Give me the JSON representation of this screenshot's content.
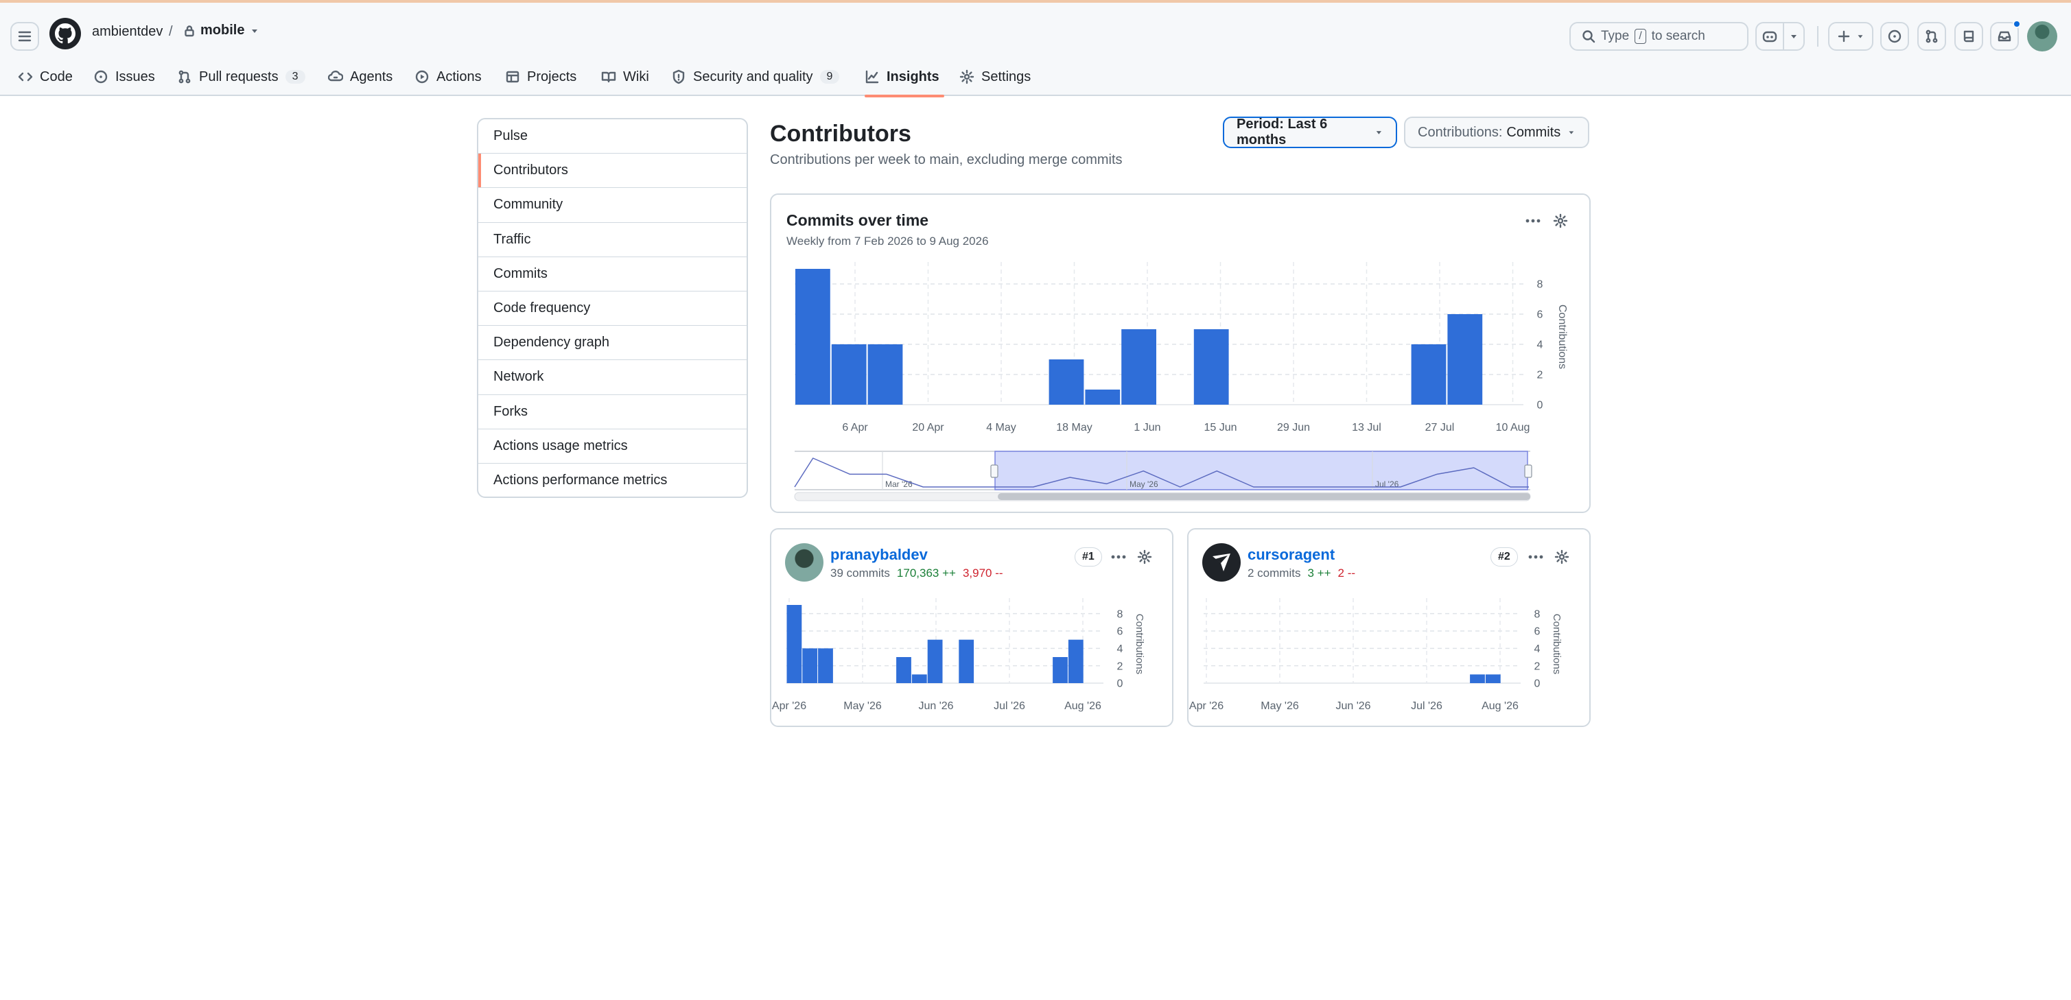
{
  "header": {
    "owner": "ambientdev",
    "separator": "/",
    "repo": "mobile",
    "search": {
      "prefix": "Type",
      "key": "/",
      "suffix": "to search"
    }
  },
  "tabs": [
    {
      "label": "Code",
      "icon": "code-icon"
    },
    {
      "label": "Issues",
      "icon": "issue-icon"
    },
    {
      "label": "Pull requests",
      "icon": "pull-request-icon",
      "count": "3"
    },
    {
      "label": "Agents",
      "icon": "agent-icon"
    },
    {
      "label": "Actions",
      "icon": "play-icon"
    },
    {
      "label": "Projects",
      "icon": "table-icon"
    },
    {
      "label": "Wiki",
      "icon": "book-icon"
    },
    {
      "label": "Security and quality",
      "icon": "shield-icon",
      "count": "9"
    },
    {
      "label": "Insights",
      "icon": "graph-icon",
      "selected": true
    },
    {
      "label": "Settings",
      "icon": "gear-icon"
    }
  ],
  "sidebar": {
    "items": [
      {
        "label": "Pulse"
      },
      {
        "label": "Contributors",
        "selected": true
      },
      {
        "label": "Community"
      },
      {
        "label": "Traffic"
      },
      {
        "label": "Commits"
      },
      {
        "label": "Code frequency"
      },
      {
        "label": "Dependency graph"
      },
      {
        "label": "Network"
      },
      {
        "label": "Forks"
      },
      {
        "label": "Actions usage metrics"
      },
      {
        "label": "Actions performance metrics"
      }
    ]
  },
  "main": {
    "title": "Contributors",
    "subtitle": "Contributions per week to main, excluding merge commits",
    "period": {
      "label": "Period: Last 6 months"
    },
    "contributions": {
      "prefix": "Contributions:",
      "value": "Commits"
    },
    "card": {
      "title": "Commits over time",
      "subtitle": "Weekly from 7 Feb 2026 to 9 Aug 2026"
    },
    "contributors": [
      {
        "name": "pranaybaldev",
        "commits": "39 commits",
        "additions": "170,363 ++",
        "deletions": "3,970 --",
        "rank": "#1"
      },
      {
        "name": "cursoragent",
        "commits": "2 commits",
        "additions": "3 ++",
        "deletions": "2 --",
        "rank": "#2"
      }
    ]
  },
  "colors": {
    "bar": "#2f6ed8",
    "accent": "#fd8c73",
    "link": "#0969da",
    "add": "#1a7f37",
    "del": "#cf222e"
  },
  "chart_data": [
    {
      "type": "bar",
      "title": "Commits over time",
      "subtitle": "Weekly from 7 Feb 2026 to 9 Aug 2026",
      "ylabel": "Contributions",
      "ylim": [
        0,
        9
      ],
      "yticks": [
        0,
        2,
        4,
        6,
        8
      ],
      "xtick_labels": [
        "6 Apr",
        "20 Apr",
        "4 May",
        "18 May",
        "1 Jun",
        "15 Jun",
        "29 Jun",
        "13 Jul",
        "27 Jul",
        "10 Aug"
      ],
      "values": [
        9,
        4,
        4,
        0,
        0,
        0,
        0,
        3,
        1,
        5,
        0,
        5,
        0,
        0,
        0,
        0,
        0,
        4,
        6,
        0
      ],
      "grid": true,
      "overview_labels": [
        "Mar '26",
        "May '26",
        "Jul '26"
      ]
    },
    {
      "type": "bar",
      "series_owner": "pranaybaldev",
      "ylabel": "Contributions",
      "ylim": [
        0,
        9
      ],
      "yticks": [
        0,
        2,
        4,
        6,
        8
      ],
      "xtick_labels": [
        "Apr '26",
        "May '26",
        "Jun '26",
        "Jul '26",
        "Aug '26"
      ],
      "values": [
        9,
        4,
        4,
        0,
        0,
        0,
        0,
        3,
        1,
        5,
        0,
        5,
        0,
        0,
        0,
        0,
        0,
        3,
        5,
        0
      ],
      "grid": true
    },
    {
      "type": "bar",
      "series_owner": "cursoragent",
      "ylabel": "Contributions",
      "ylim": [
        0,
        9
      ],
      "yticks": [
        0,
        2,
        4,
        6,
        8
      ],
      "xtick_labels": [
        "Apr '26",
        "May '26",
        "Jun '26",
        "Jul '26",
        "Aug '26"
      ],
      "values": [
        0,
        0,
        0,
        0,
        0,
        0,
        0,
        0,
        0,
        0,
        0,
        0,
        0,
        0,
        0,
        0,
        0,
        1,
        1,
        0
      ],
      "grid": true
    }
  ]
}
